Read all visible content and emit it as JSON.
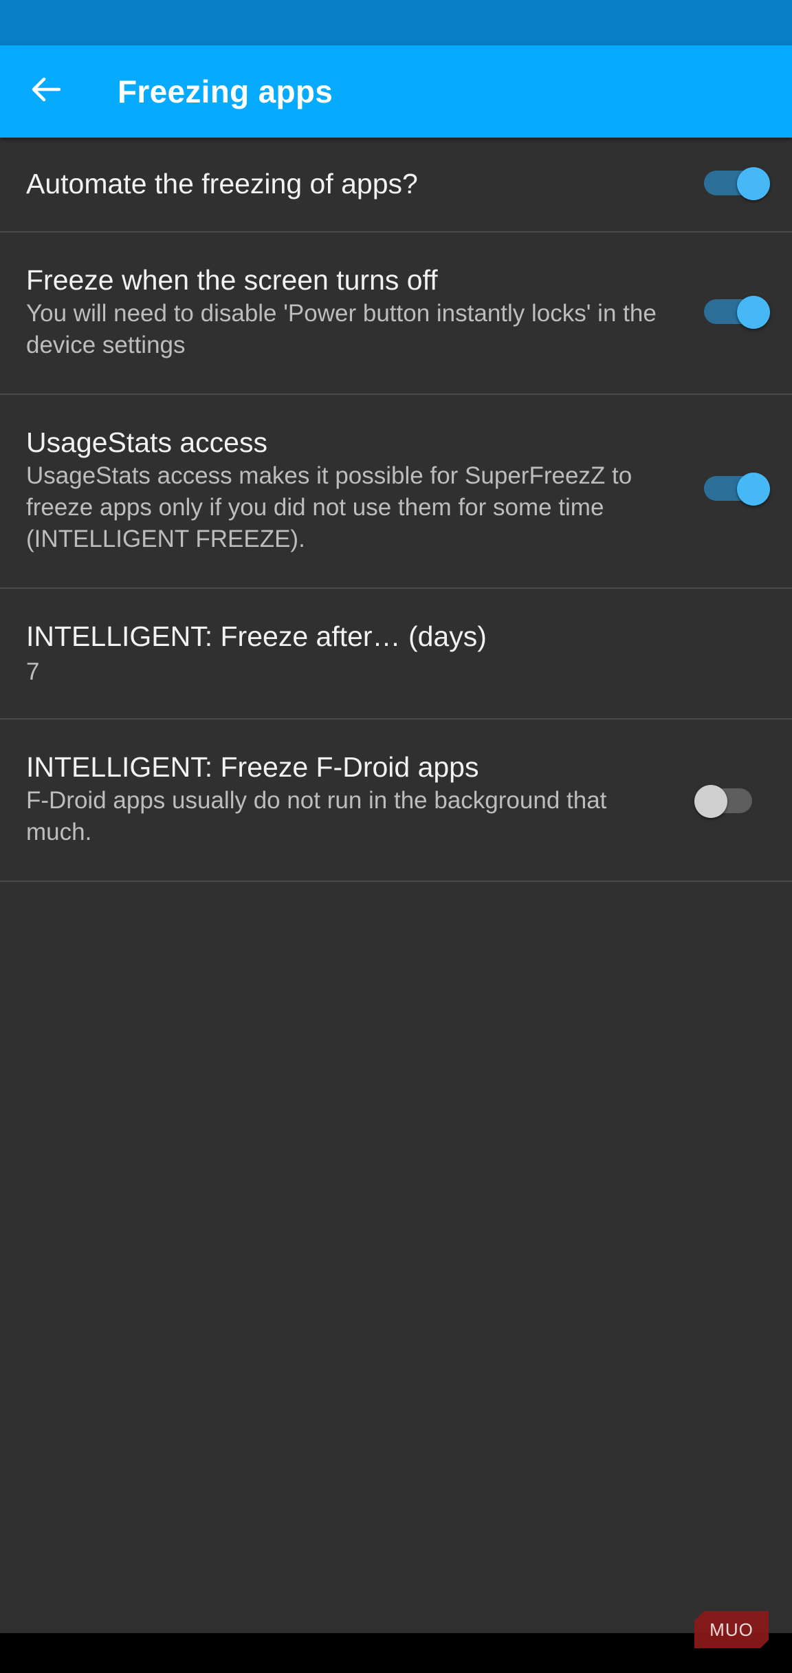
{
  "app_bar": {
    "title": "Freezing apps",
    "back_icon": "arrow-back-icon"
  },
  "settings": {
    "automate": {
      "title": "Automate the freezing of apps?",
      "enabled": true
    },
    "screen_off": {
      "title": "Freeze when the screen turns off",
      "summary": "You will need to disable 'Power button instantly locks' in the device settings",
      "enabled": true
    },
    "usage_stats": {
      "title": "UsageStats access",
      "summary": "UsageStats access makes it possible for SuperFreezZ to freeze apps only if you did not use them for some time (INTELLIGENT FREEZE).",
      "enabled": true
    },
    "freeze_after": {
      "title": "INTELLIGENT: Freeze after… (days)",
      "value": "7"
    },
    "fdroid": {
      "title": "INTELLIGENT: Freeze F-Droid apps",
      "summary": "F-Droid apps usually do not run in the background that much.",
      "enabled": false
    }
  },
  "watermark": {
    "text": "MUO"
  },
  "colors": {
    "status_bar": "#087fc6",
    "app_bar": "#06aaff",
    "background": "#303030",
    "switch_on_thumb": "#45b8f5",
    "switch_on_track": "#2b6f99",
    "switch_off_thumb": "#cfcfcf",
    "switch_off_track": "#5e5e5e"
  }
}
